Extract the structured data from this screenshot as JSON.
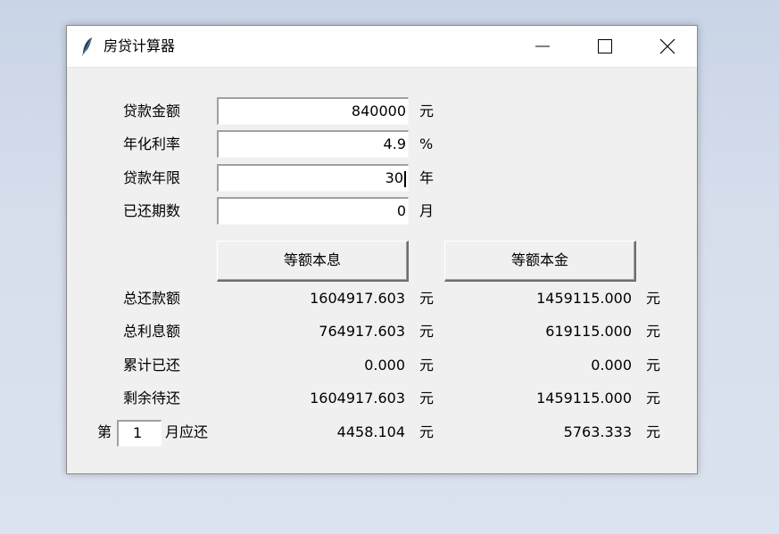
{
  "window": {
    "title": "房贷计算器"
  },
  "inputs": [
    {
      "label": "贷款金额",
      "value": "840000",
      "unit": "元"
    },
    {
      "label": "年化利率",
      "value": "4.9",
      "unit": "%"
    },
    {
      "label": "贷款年限",
      "value": "30",
      "unit": "年"
    },
    {
      "label": "已还期数",
      "value": "0",
      "unit": "月"
    }
  ],
  "buttons": {
    "equal_installment": "等额本息",
    "equal_principal": "等额本金"
  },
  "results": [
    {
      "label": "总还款额",
      "col1": "1604917.603",
      "col2": "1459115.000",
      "unit": "元"
    },
    {
      "label": "总利息额",
      "col1": "764917.603",
      "col2": "619115.000",
      "unit": "元"
    },
    {
      "label": "累计已还",
      "col1": "0.000",
      "col2": "0.000",
      "unit": "元"
    },
    {
      "label": "剩余待还",
      "col1": "1604917.603",
      "col2": "1459115.000",
      "unit": "元"
    }
  ],
  "monthly": {
    "prefix": "第",
    "month_value": "1",
    "suffix": "月应还",
    "col1": "4458.104",
    "col2": "5763.333",
    "unit": "元"
  },
  "icons": {
    "app": "feather-icon",
    "minimize": "minimize-icon",
    "maximize": "maximize-icon",
    "close": "close-icon"
  }
}
